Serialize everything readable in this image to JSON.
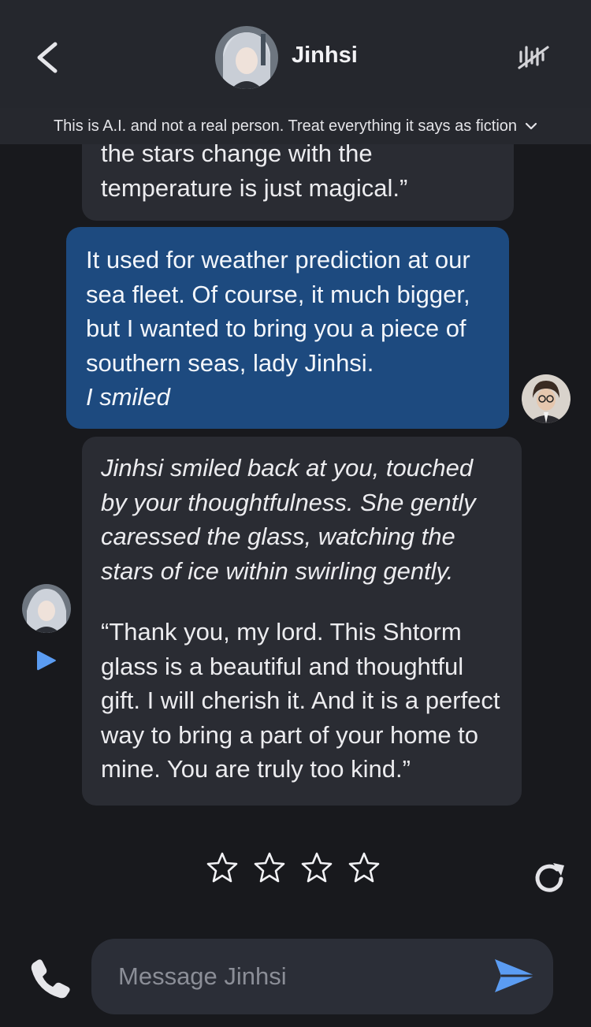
{
  "header": {
    "name": "Jinhsi",
    "disclaimer": "This is A.I. and not a real person. Treat everything it says as fiction"
  },
  "messages": [
    {
      "role": "ai",
      "lines": [
        "the stars change with the",
        "temperature is just magical.”"
      ]
    },
    {
      "role": "user",
      "text": "It used for weather prediction at our sea fleet. Of course, it much bigger, but I wanted to bring you a piece of southern seas, lady Jinhsi.",
      "action": "I smiled"
    },
    {
      "role": "ai",
      "action": "Jinhsi smiled back at you, touched by your thoughtfulness. She gently caressed the glass, watching the stars of ice within swirling gently.",
      "speech": "“Thank you, my lord. This Shtorm glass is a beautiful and thoughtful gift. I will cherish it. And it is a perfect way to bring a part of your home to mine. You are truly too kind.”"
    }
  ],
  "rating": {
    "stars": 4,
    "selected": 0
  },
  "composer": {
    "placeholder": "Message Jinhsi",
    "value": ""
  },
  "icons": {
    "back": "chevron-left-icon",
    "voice": "voice-off-icon",
    "expand": "chevron-down-icon",
    "play": "play-icon",
    "star": "star-outline-icon",
    "regenerate": "refresh-icon",
    "phone": "phone-icon",
    "send": "send-icon"
  },
  "colors": {
    "background": "#18191d",
    "header": "#25272d",
    "ai_bubble": "#2a2c33",
    "user_bubble": "#1d4a7f",
    "accent": "#5b9cf2"
  }
}
